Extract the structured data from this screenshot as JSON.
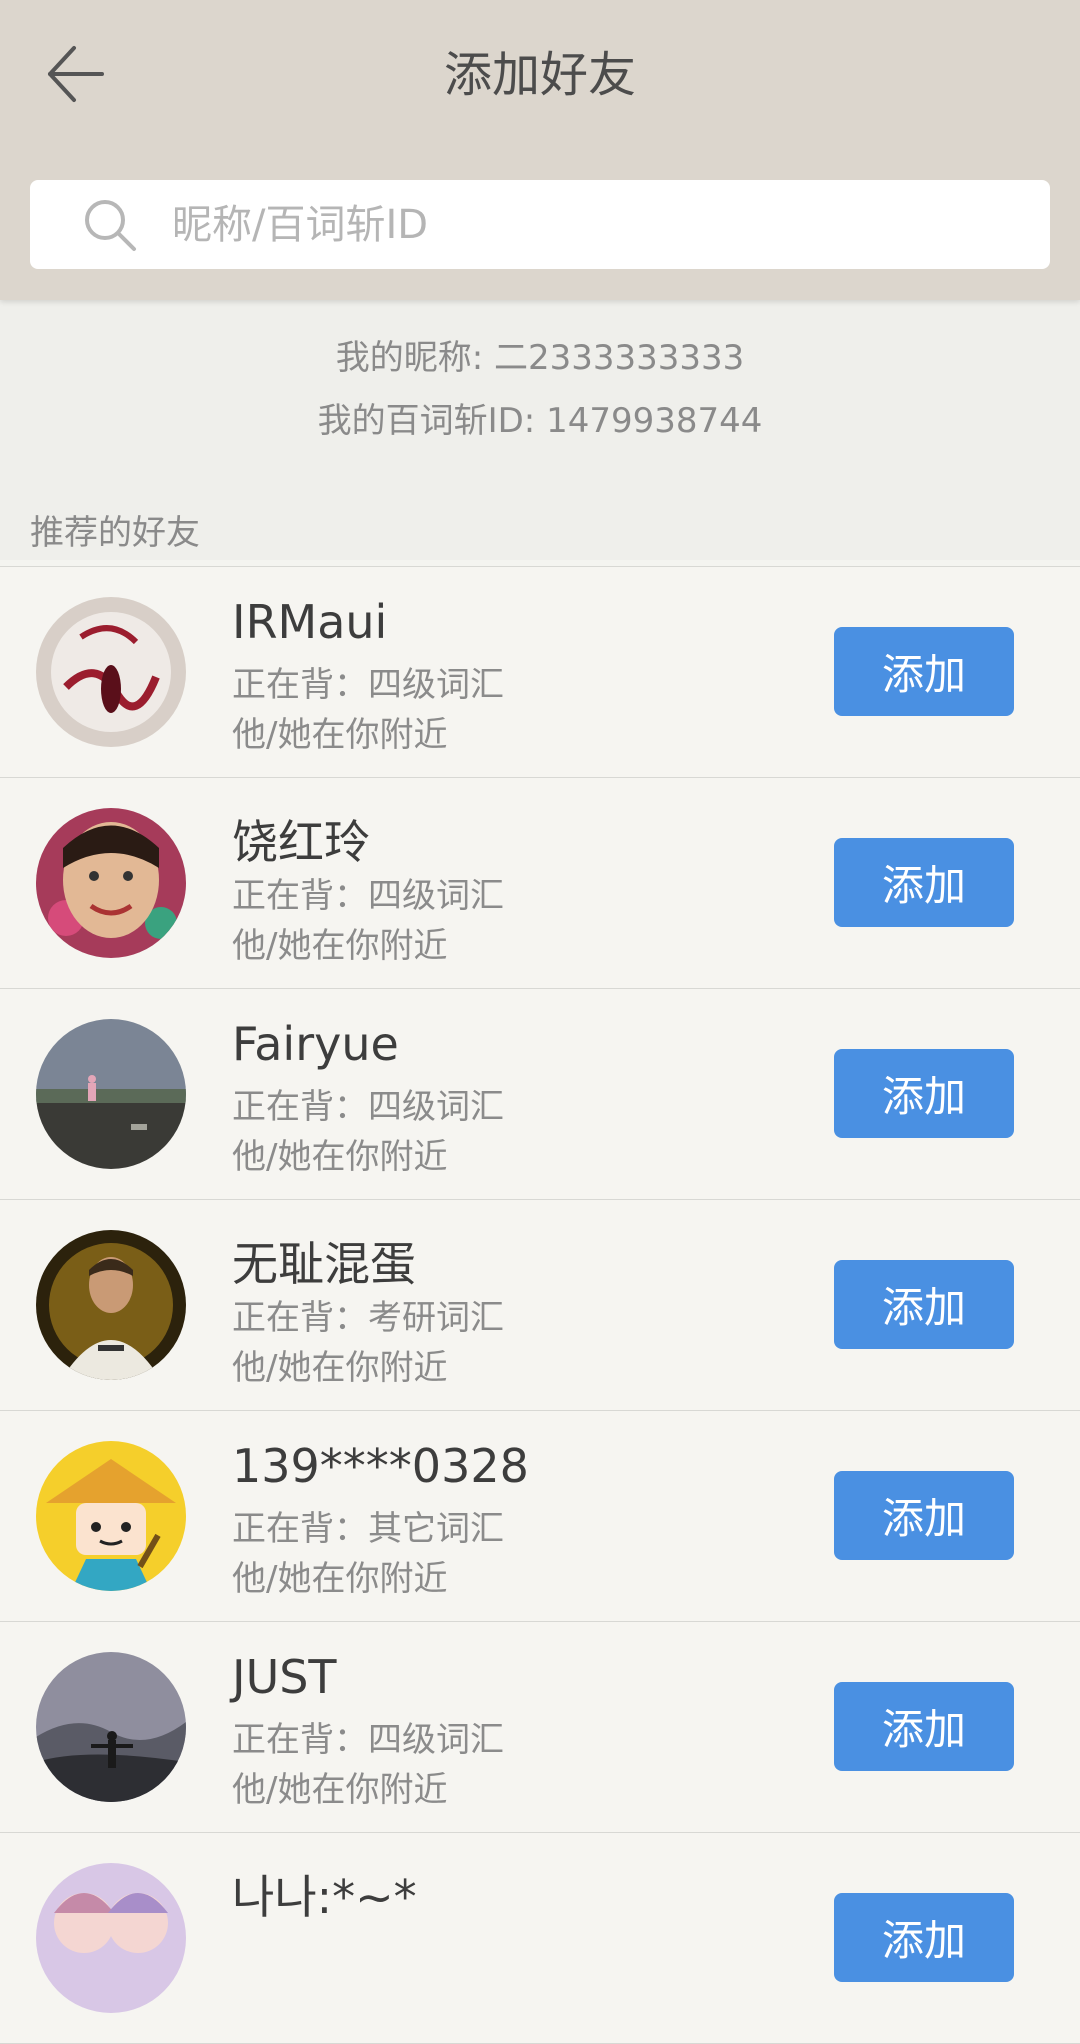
{
  "header": {
    "title": "添加好友",
    "back_icon": "arrow-left-icon"
  },
  "search": {
    "placeholder": "昵称/百词斩ID",
    "icon": "search-icon",
    "value": ""
  },
  "me": {
    "nickname_line": "我的昵称: 二2333333333",
    "id_line": "我的百词斩ID: 1479938744"
  },
  "section": {
    "recommended_label": "推荐的好友"
  },
  "add_label": "添加",
  "friends": [
    {
      "name": "IRMaui",
      "learning": "正在背：四级词汇",
      "nearby": "他/她在你附近",
      "avatar": "dessert-plate"
    },
    {
      "name": "饶红玲",
      "learning": "正在背：四级词汇",
      "nearby": "他/她在你附近",
      "avatar": "smiling-face"
    },
    {
      "name": "Fairyue",
      "learning": "正在背：四级词汇",
      "nearby": "他/她在你附近",
      "avatar": "field-dusk"
    },
    {
      "name": "无耻混蛋",
      "learning": "正在背：考研词汇",
      "nearby": "他/她在你附近",
      "avatar": "football-player"
    },
    {
      "name": "139****0328",
      "learning": "正在背：其它词汇",
      "nearby": "他/她在你附近",
      "avatar": "cartoon-straw-hat"
    },
    {
      "name": "JUST",
      "learning": "正在背：四级词汇",
      "nearby": "他/她在你附近",
      "avatar": "mountain-person"
    },
    {
      "name": "나나:*~*",
      "learning": "",
      "nearby": "",
      "avatar": "anime-girls"
    }
  ],
  "colors": {
    "header_bg": "#dcd6cd",
    "button_bg": "#4a90e2",
    "page_bg": "#f4f4f0"
  }
}
